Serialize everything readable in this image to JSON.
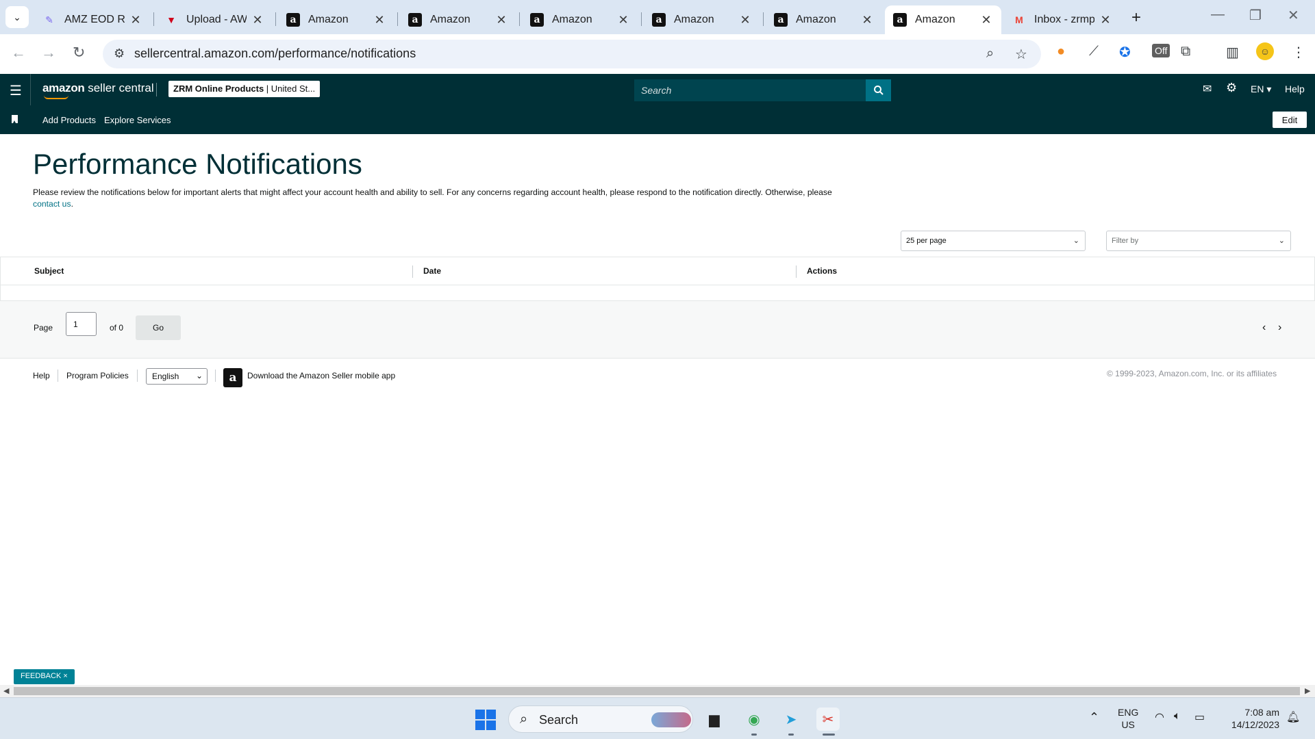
{
  "browser": {
    "tabs": [
      {
        "title": "AMZ EOD Re",
        "favicon": "clickup-icon"
      },
      {
        "title": "Upload - AW",
        "favicon": "upload-icon"
      },
      {
        "title": "Amazon",
        "favicon": "amazon-icon"
      },
      {
        "title": "Amazon",
        "favicon": "amazon-icon"
      },
      {
        "title": "Amazon",
        "favicon": "amazon-icon"
      },
      {
        "title": "Amazon",
        "favicon": "amazon-icon"
      },
      {
        "title": "Amazon",
        "favicon": "amazon-icon"
      },
      {
        "title": "Amazon",
        "favicon": "amazon-icon"
      },
      {
        "title": "Inbox - zrmp",
        "favicon": "gmail-icon"
      }
    ],
    "url": "sellercentral.amazon.com/performance/notifications"
  },
  "header": {
    "logo_bold": "amazon",
    "logo_rest": " seller central",
    "account_name": "ZRM Online Products",
    "account_region": " | United St...",
    "search_placeholder": "Search",
    "language": "EN",
    "help": "Help"
  },
  "subnav": {
    "items": [
      "Add Products",
      "Explore Services"
    ],
    "edit": "Edit"
  },
  "page": {
    "title": "Performance Notifications",
    "description": "Please review the notifications below for important alerts that might affect your account health and ability to sell. For any concerns regarding account health, please respond to the notification directly. Otherwise, please",
    "contact_link": "contact us",
    "per_page": "25 per page",
    "filter_placeholder": "Filter by",
    "columns": [
      "Subject",
      "Date",
      "Actions"
    ]
  },
  "pager": {
    "page_label": "Page",
    "page_value": "1",
    "of_label": "of 0",
    "go": "Go"
  },
  "footer": {
    "help": "Help",
    "policies": "Program Policies",
    "language": "English",
    "app_text": "Download the Amazon Seller mobile app",
    "copyright": "© 1999-2023, Amazon.com, Inc. or its affiliates"
  },
  "feedback": "FEEDBACK ×",
  "taskbar": {
    "search": "Search",
    "lang_top": "ENG",
    "lang_bottom": "US",
    "time": "7:08 am",
    "date": "14/12/2023"
  },
  "colors": {
    "header_bg": "#002f36",
    "accent": "#007185",
    "title": "#002f36"
  }
}
